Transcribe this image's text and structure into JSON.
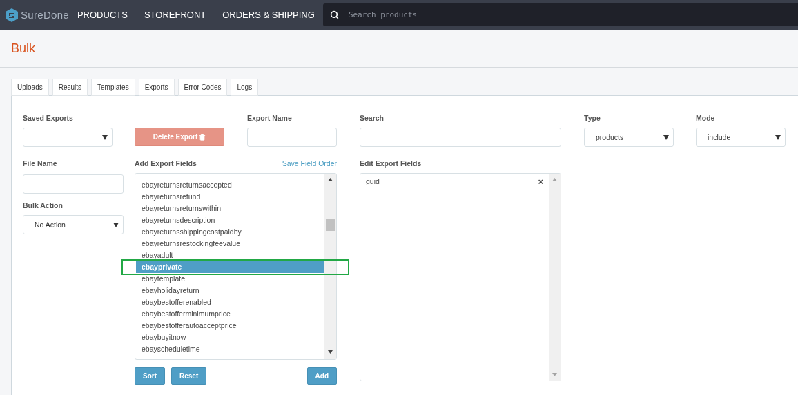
{
  "navbar": {
    "logo": "SureDone",
    "links": [
      "PRODUCTS",
      "STOREFRONT",
      "ORDERS & SHIPPING"
    ],
    "search": {
      "placeholder": "Search products"
    }
  },
  "page_title": "Bulk",
  "tabs": [
    {
      "label": "Uploads"
    },
    {
      "label": "Results"
    },
    {
      "label": "Templates"
    },
    {
      "label": "Exports"
    },
    {
      "label": "Error Codes"
    },
    {
      "label": "Logs"
    }
  ],
  "saved_exports": {
    "label": "Saved Exports"
  },
  "delete_button": {
    "label": "Delete Export",
    "disabled": true
  },
  "export_name": {
    "label": "Export Name"
  },
  "search": {
    "label": "Search"
  },
  "type": {
    "label": "Type",
    "value": "products"
  },
  "mode": {
    "label": "Mode",
    "value": "include"
  },
  "file_name": {
    "label": "File Name"
  },
  "bulk_action": {
    "label": "Bulk Action",
    "value": "No Action"
  },
  "add_export_fields": {
    "label": "Add Export Fields",
    "link": "Save Field Order",
    "items": [
      {
        "label": "ebayreturnsreturnsaccepted",
        "selected": false,
        "highlighted": false
      },
      {
        "label": "ebayreturnsrefund",
        "selected": false,
        "highlighted": false
      },
      {
        "label": "ebayreturnsreturnswithin",
        "selected": false,
        "highlighted": false
      },
      {
        "label": "ebayreturnsdescription",
        "selected": false,
        "highlighted": false
      },
      {
        "label": "ebayreturnsshippingcostpaidby",
        "selected": false,
        "highlighted": false
      },
      {
        "label": "ebayreturnsrestockingfeevalue",
        "selected": false,
        "highlighted": false
      },
      {
        "label": "ebayadult",
        "selected": false,
        "highlighted": false
      },
      {
        "label": "ebayprivate",
        "selected": true,
        "highlighted": true
      },
      {
        "label": "ebaytemplate",
        "selected": false,
        "highlighted": false
      },
      {
        "label": "ebayholidayreturn",
        "selected": false,
        "highlighted": false
      },
      {
        "label": "ebaybestofferenabled",
        "selected": false,
        "highlighted": false
      },
      {
        "label": "ebaybestofferminimumprice",
        "selected": false,
        "highlighted": false
      },
      {
        "label": "ebaybestofferautoacceptprice",
        "selected": false,
        "highlighted": false
      },
      {
        "label": "ebaybuyitnow",
        "selected": false,
        "highlighted": false
      },
      {
        "label": "ebayscheduletime",
        "selected": false,
        "highlighted": false
      }
    ],
    "buttons": [
      "Sort",
      "Reset",
      "Add"
    ]
  },
  "edit_export_fields": {
    "label": "Edit Export Fields",
    "items": [
      {
        "label": "guid",
        "remove": "×"
      }
    ]
  }
}
